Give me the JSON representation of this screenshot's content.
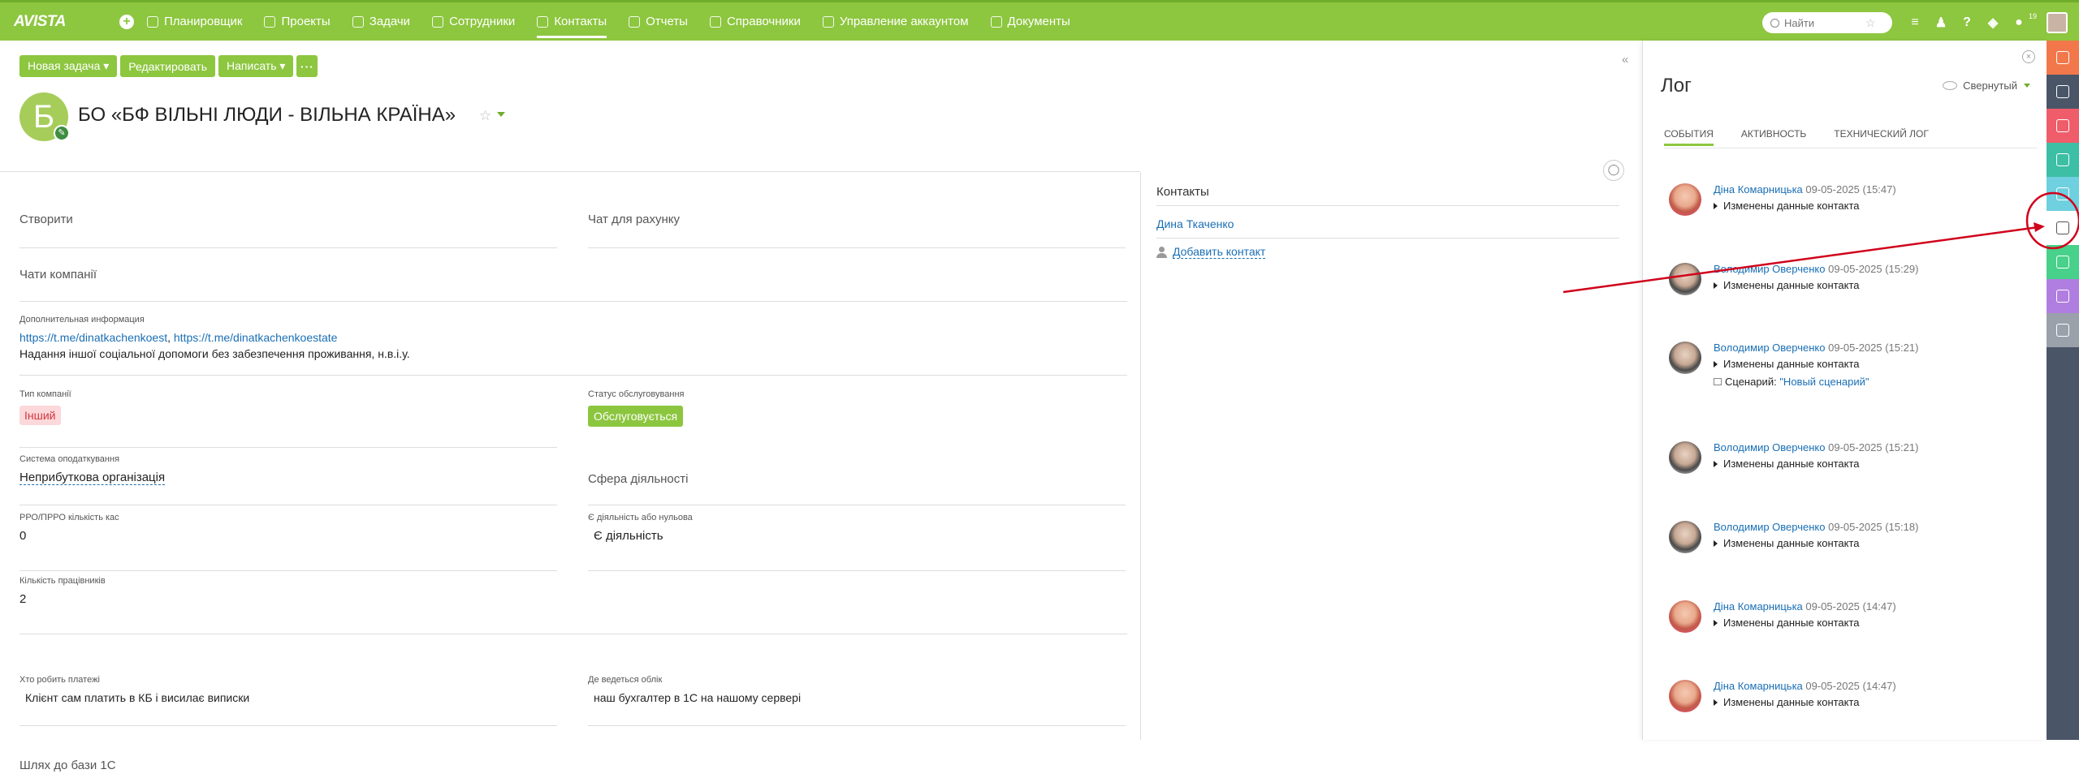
{
  "topbar": {
    "logo": "AVISTA",
    "nav": [
      {
        "label": "Планировщик",
        "icon": "planner-icon",
        "active": false
      },
      {
        "label": "Проекты",
        "icon": "projects-icon",
        "active": false
      },
      {
        "label": "Задачи",
        "icon": "tasks-icon",
        "active": false
      },
      {
        "label": "Сотрудники",
        "icon": "employees-icon",
        "active": false
      },
      {
        "label": "Контакты",
        "icon": "contacts-icon",
        "active": true
      },
      {
        "label": "Отчеты",
        "icon": "reports-icon",
        "active": false
      },
      {
        "label": "Справочники",
        "icon": "directories-icon",
        "active": false
      },
      {
        "label": "Управление аккаунтом",
        "icon": "account-icon",
        "active": false
      },
      {
        "label": "Документы",
        "icon": "documents-icon",
        "active": false
      }
    ],
    "search_placeholder": "Найти",
    "notif_count": "19"
  },
  "actions": {
    "new_task": "Новая задача ▾",
    "edit": "Редактировать",
    "write": "Написать ▾",
    "more": "···"
  },
  "company": {
    "initial": "Б",
    "title": "БО «БФ ВІЛЬНІ ЛЮДИ - ВІЛЬНА КРАЇНА»"
  },
  "fields": {
    "create": "Створити",
    "chat_for_invoice": "Чат для рахунку",
    "company_chats": "Чати компанії",
    "extra_info_label": "Дополнительная информация",
    "extra_link_1": "https://t.me/dinatkachenkoest",
    "extra_link_sep": ", ",
    "extra_link_2": "https://t.me/dinatkachenkoestate",
    "extra_text": "Надання іншої соціальної допомоги без забезпечення проживання, н.в.і.у.",
    "company_type_label": "Тип компанії",
    "company_type_value": "Інший",
    "service_status_label": "Статус обслуговування",
    "service_status_value": "Обслуговується",
    "tax_system_label": "Система оподаткування",
    "tax_system_value": "Неприбуткова організація",
    "activity_sphere": "Сфера діяльності",
    "rro_label": "РРО/ПРРО кількість кас",
    "rro_value": "0",
    "activity_label": "Є діяльність або нульова",
    "activity_value": "Є діяльність",
    "workers_label": "Кількість працівників",
    "workers_value": "2",
    "payments_label": "Хто робить платежі",
    "payments_value": "Клієнт сам платить в КБ і висилає виписки",
    "accounting_label": "Де ведеться облік",
    "accounting_value": "наш бухгалтер в 1С на нашому сервері",
    "db_path": "Шлях до бази 1С"
  },
  "contacts": {
    "title": "Контакты",
    "items": [
      "Дина Ткаченко"
    ],
    "add": "Добавить контакт"
  },
  "log": {
    "title": "Лог",
    "mode": "Свернутый",
    "tabs": [
      "События",
      "Активность",
      "Технический лог"
    ],
    "entries": [
      {
        "name": "Діна Комарницька",
        "time": "09-05-2025 (15:47)",
        "what": "Изменены данные контакта",
        "avatar": "f"
      },
      {
        "name": "Володимир Оверченко",
        "time": "09-05-2025 (15:29)",
        "what": "Изменены данные контакта",
        "avatar": "m"
      },
      {
        "name": "Володимир Оверченко",
        "time": "09-05-2025 (15:21)",
        "what": "Изменены данные контакта",
        "avatar": "m",
        "scenario_label": "Сценарий: ",
        "scenario_value": "\"Новый сценарий\""
      },
      {
        "name": "Володимир Оверченко",
        "time": "09-05-2025 (15:21)",
        "what": "Изменены данные контакта",
        "avatar": "m"
      },
      {
        "name": "Володимир Оверченко",
        "time": "09-05-2025 (15:18)",
        "what": "Изменены данные контакта",
        "avatar": "m"
      },
      {
        "name": "Діна Комарницька",
        "time": "09-05-2025 (14:47)",
        "what": "Изменены данные контакта",
        "avatar": "f"
      },
      {
        "name": "Діна Комарницька",
        "time": "09-05-2025 (14:47)",
        "what": "Изменены данные контакта",
        "avatar": "f"
      }
    ]
  },
  "rail": [
    {
      "icon": "chat-icon",
      "color": "#f2784b"
    },
    {
      "icon": "finance-icon",
      "color": "#4a5568"
    },
    {
      "icon": "tasks-check-icon",
      "color": "#ef5d6a"
    },
    {
      "icon": "briefcase-icon",
      "color": "#3dbfa6"
    },
    {
      "icon": "document-icon",
      "color": "#6fd0df"
    },
    {
      "icon": "log-icon",
      "color": "#ffffff"
    },
    {
      "icon": "key-icon",
      "color": "#48d18a"
    },
    {
      "icon": "analytics-icon",
      "color": "#b07ee0"
    },
    {
      "icon": "history-icon",
      "color": "#9aa1ab"
    }
  ],
  "colors": {
    "brand": "#8dc63f",
    "link": "#1a6fb5",
    "annotation": "#d0021b"
  }
}
